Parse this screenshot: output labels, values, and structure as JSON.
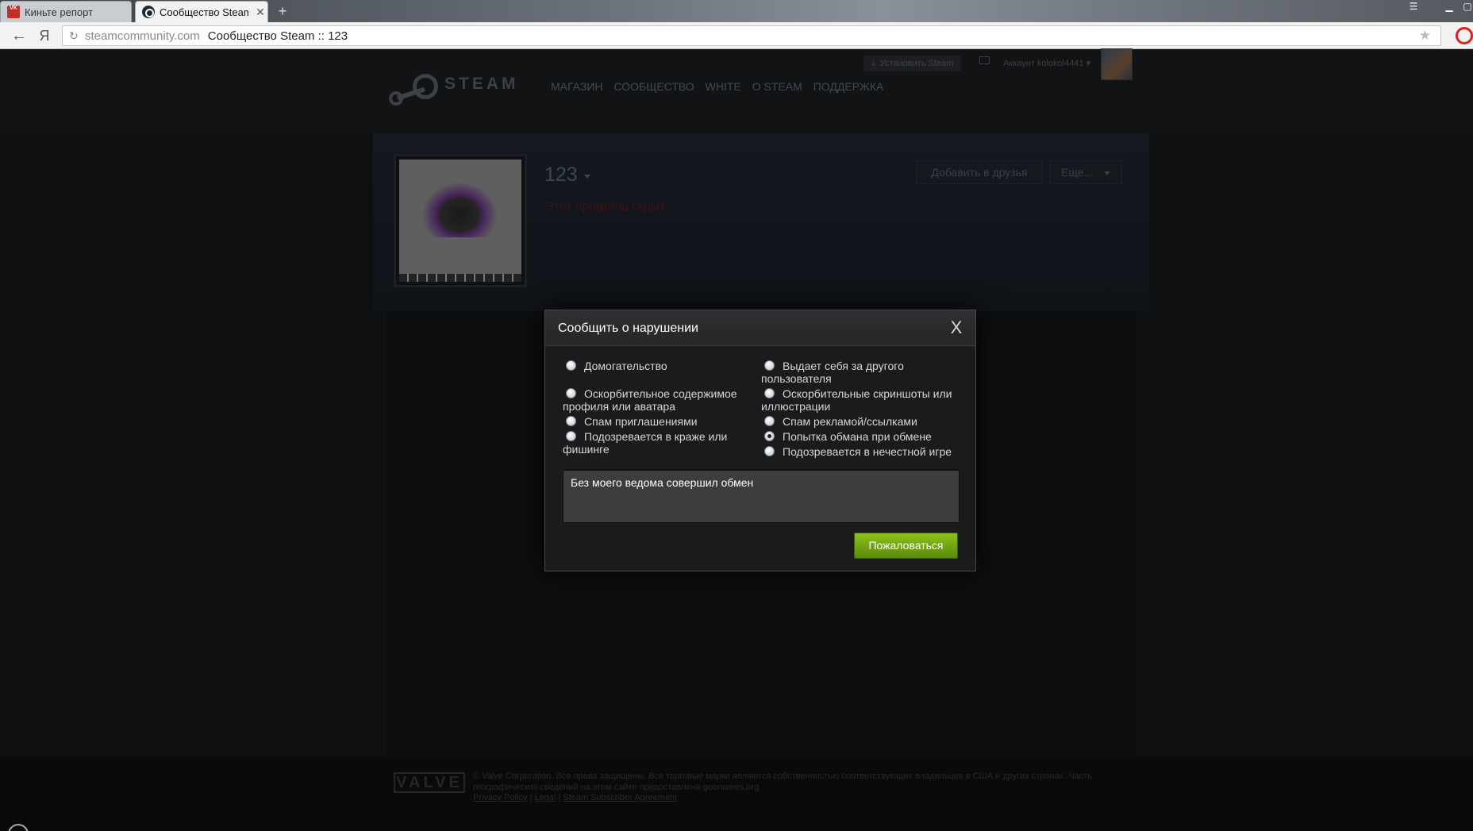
{
  "browser": {
    "tabs": [
      {
        "title": "Киньте репорт",
        "active": false
      },
      {
        "title": "Сообщество Steam ::",
        "active": true
      }
    ],
    "new_tab": "+",
    "address": {
      "host": "steamcommunity.com",
      "title": "Сообщество Steam :: 123"
    },
    "icons": {
      "back": "back-arrow-icon",
      "yandex": "yandex-icon",
      "reload": "reload-icon",
      "star": "bookmark-star-icon"
    }
  },
  "steam_header": {
    "logo_text": "STEAM",
    "nav": [
      "МАГАЗИН",
      "СООБЩЕСТВО",
      "WHITE",
      "О STEAM",
      "ПОДДЕРЖКА"
    ],
    "install_label": "Установить Steam",
    "account_label": "Аккаунт kolokol4441"
  },
  "profile": {
    "persona_name": "123",
    "private_message": "Этот профиль скрыт.",
    "add_friend_label": "Добавить в друзья",
    "more_label": "Еще..."
  },
  "modal": {
    "title": "Сообщить о нарушении",
    "close_symbol": "X",
    "reasons": [
      {
        "label": "Домогательство",
        "checked": false
      },
      {
        "label": "Выдает себя за другого пользователя",
        "checked": false
      },
      {
        "label": "Оскорбительное содержимое профиля или аватара",
        "checked": false
      },
      {
        "label": "Оскорбительные скриншоты или иллюстрации",
        "checked": false
      },
      {
        "label": "Спам приглашениями",
        "checked": false
      },
      {
        "label": "Спам рекламой/ссылками",
        "checked": false
      },
      {
        "label": "Подозревается в краже или фишинге",
        "checked": false
      },
      {
        "label": "Попытка обмана при обмене",
        "checked": true
      },
      {
        "label": "Подозревается в нечестной игре",
        "checked": false
      }
    ],
    "text_value": "Без моего ведома совершил обмен",
    "submit_label": "Пожаловаться",
    "accent_color": "#7aad14"
  },
  "footer": {
    "valve_logo": "VALVE",
    "copyright": "© Valve Corporation. Все права защищены. Все торговые марки являются собственностью соответствующих владельцев в США и других странах. Часть географических сведений на этом сайте предоставлена geonames.org",
    "links": [
      "Privacy Policy",
      "Legal",
      "Steam Subscriber Agreement"
    ]
  }
}
